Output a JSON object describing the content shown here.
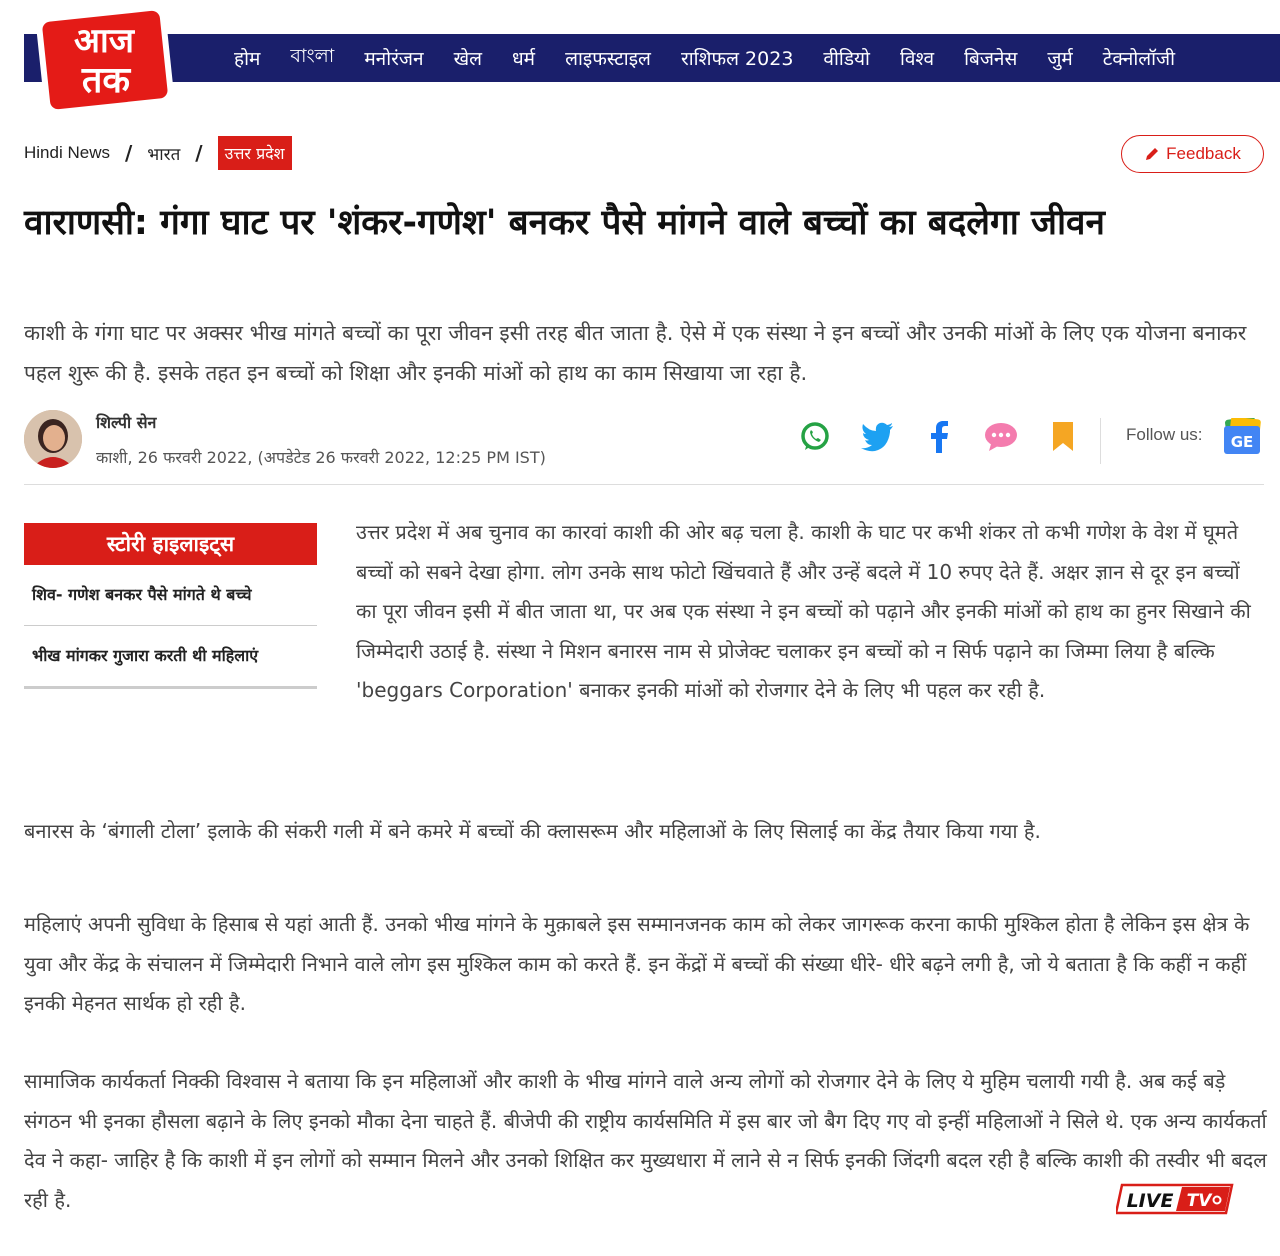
{
  "header": {
    "logo_text_top": "आज",
    "logo_text_bottom": "तक",
    "nav": [
      "होम",
      "বাংলা",
      "मनोरंजन",
      "खेल",
      "धर्म",
      "लाइफस्टाइल",
      "राशिफल 2023",
      "वीडियो",
      "विश्व",
      "बिजनेस",
      "जुर्म",
      "टेक्नोलॉजी"
    ],
    "brand_color": "#1a1f6b",
    "accent_color": "#d91e18"
  },
  "breadcrumb": {
    "home": "Hindi News",
    "section": "भारत",
    "current": "उत्तर प्रदेश"
  },
  "feedback": {
    "label": "Feedback",
    "icon": "pencil-icon"
  },
  "article": {
    "headline": "वाराणसी: गंगा घाट पर 'शंकर-गणेश' बनकर पैसे मांगने वाले बच्चों का बदलेगा जीवन",
    "summary": "काशी के गंगा घाट पर अक्सर भीख मांगते बच्चों का पूरा जीवन इसी तरह बीत जाता है. ऐसे में एक संस्था ने इन बच्चों और उनकी मांओं के लिए एक योजना बनाकर पहल शुरू की है. इसके तहत इन बच्चों को शिक्षा और इनकी मांओं को हाथ का काम सिखाया जा रहा है.",
    "author": "शिल्पी सेन",
    "dateline": "काशी, 26 फरवरी 2022, (अपडेटेड 26 फरवरी 2022, 12:25 PM IST)",
    "share_icons": [
      "whatsapp-icon",
      "twitter-icon",
      "facebook-icon",
      "comment-icon",
      "bookmark-icon"
    ],
    "follow_label": "Follow us:",
    "highlights_title": "स्टोरी हाइलाइट्स",
    "highlights": [
      "शिव- गणेश बनकर पैसे मांगते थे बच्चे",
      "भीख मांगकर गुजारा करती थी महिलाएं"
    ],
    "intro_before": "उत्तर प्रदेश में अब चुनाव का कारवां काशी की ओर बढ़ चला है. काशी के घाट पर कभी शंकर तो कभी गणेश के वेश में घूमते बच्चों को सबने देखा होगा. लोग उनके साथ फोटो खिंचवाते हैं और उन्हें बदले में 10 रुपए देते हैं. अक्षर ज्ञान से दूर इन बच्चों का पूरा जीवन इसी में बीत जाता था, पर अब एक संस्था ने इन बच्चों को पढ़ाने और इनकी मांओं को हाथ का हुनर सिखाने की जिम्मेदारी उठाई है. संस्था ने मिशन बनारस नाम से प्रोजेक्ट चलाकर इन बच्चों को न सिर्फ पढ़ाने का जिम्मा लिया है बल्कि ",
    "intro_latin": "'beggars Corporation'",
    "intro_after": " बनाकर इनकी मांओं को रोजगार देने के लिए भी पहल कर रही है.",
    "para1": "बनारस के ‘बंगाली टोला’ इलाके की संकरी गली में बने कमरे में बच्चों की क्लासरूम और महिलाओं के लिए सिलाई का केंद्र तैयार किया गया है.",
    "para2": "महिलाएं अपनी सुविधा के हिसाब से यहां आती हैं. उनको भीख मांगने के मुक़ाबले इस सम्मानजनक काम को लेकर जागरूक करना काफी मुश्किल होता है लेकिन इस क्षेत्र के युवा और केंद्र के संचालन में जिम्मेदारी निभाने वाले लोग इस मुश्किल काम को करते हैं. इन केंद्रों में बच्चों की संख्या धीरे- धीरे बढ़ने लगी है, जो ये बताता है कि कहीं न कहीं इनकी मेहनत सार्थक हो रही है.",
    "para3": "सामाजिक कार्यकर्ता निक्की विश्वास ने बताया कि इन महिलाओं और काशी के भीख मांगने वाले अन्य लोगों को रोजगार देने के लिए ये मुहिम चलायी गयी है. अब कई बड़े संगठन भी इनका हौसला बढ़ाने के लिए इनको मौका देना चाहते हैं. बीजेपी की राष्ट्रीय कार्यसमिति में इस बार जो बैग दिए गए वो इन्हीं महिलाओं ने सिले थे. एक अन्य कार्यकर्ता देव ने कहा- जाहिर है कि काशी में इन लोगों को सम्मान मिलने और उनको शिक्षित कर मुख्यधारा में लाने से न सिर्फ इनकी जिंदगी बदल रही है बल्कि काशी की तस्वीर भी बदल रही है."
  },
  "live_tv": {
    "text_live": "LIVE",
    "text_tv": "TV"
  }
}
